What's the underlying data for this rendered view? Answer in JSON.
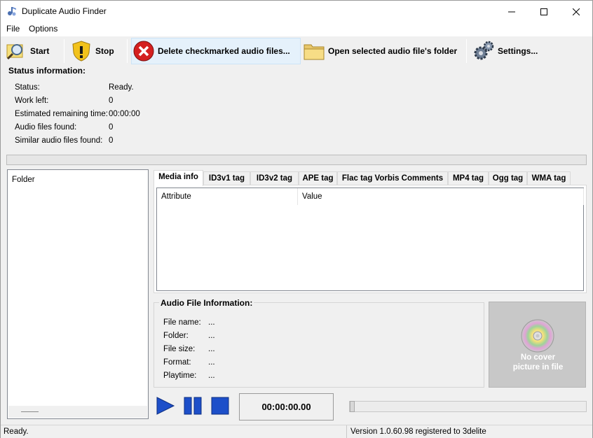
{
  "window": {
    "title": "Duplicate Audio Finder"
  },
  "menu": {
    "items": [
      "File",
      "Options"
    ]
  },
  "toolbar": {
    "start_label": "Start",
    "stop_label": "Stop",
    "delete_label": "Delete checkmarked audio files...",
    "open_folder_label": "Open selected audio file's folder",
    "settings_label": "Settings..."
  },
  "status": {
    "title": "Status information:",
    "rows": [
      {
        "label": "Status:",
        "value": "Ready."
      },
      {
        "label": "Work left:",
        "value": "0"
      },
      {
        "label": "Estimated remaining time:",
        "value": "00:00:00"
      },
      {
        "label": "Audio files found:",
        "value": "0"
      },
      {
        "label": "Similar audio files found:",
        "value": "0"
      }
    ],
    "progress": 0
  },
  "folder_panel": {
    "header": "Folder"
  },
  "tabs": [
    "Media info",
    "ID3v1 tag",
    "ID3v2 tag",
    "APE tag",
    "Flac tag Vorbis Comments",
    "MP4 tag",
    "Ogg tag",
    "WMA tag"
  ],
  "media_info": {
    "columns": [
      "Attribute",
      "Value"
    ]
  },
  "audio_info": {
    "title": "Audio File Information:",
    "rows": [
      {
        "label": "File name:",
        "value": "..."
      },
      {
        "label": "Folder:",
        "value": "..."
      },
      {
        "label": "File size:",
        "value": "..."
      },
      {
        "label": "Format:",
        "value": "..."
      },
      {
        "label": "Playtime:",
        "value": "..."
      }
    ]
  },
  "cover": {
    "line1": "No cover",
    "line2": "picture in file"
  },
  "player": {
    "time": "00:00:00.00",
    "position": 0
  },
  "statusbar": {
    "left": "Ready.",
    "right": "Version 1.0.60.98 registered to 3delite"
  },
  "colors": {
    "accent_blue": "#1d4fc9",
    "delete_red": "#d42020",
    "cover_bg": "#c8c8c8"
  }
}
